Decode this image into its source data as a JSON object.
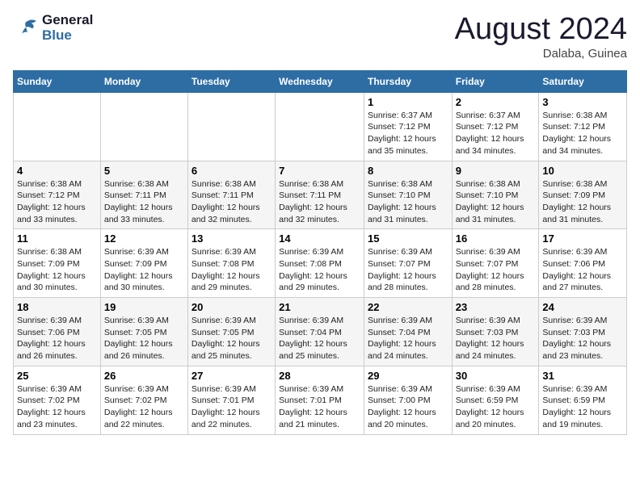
{
  "logo": {
    "line1": "General",
    "line2": "Blue"
  },
  "title": "August 2024",
  "location": "Dalaba, Guinea",
  "days_header": [
    "Sunday",
    "Monday",
    "Tuesday",
    "Wednesday",
    "Thursday",
    "Friday",
    "Saturday"
  ],
  "weeks": [
    [
      {
        "day": "",
        "info": ""
      },
      {
        "day": "",
        "info": ""
      },
      {
        "day": "",
        "info": ""
      },
      {
        "day": "",
        "info": ""
      },
      {
        "day": "1",
        "info": "Sunrise: 6:37 AM\nSunset: 7:12 PM\nDaylight: 12 hours\nand 35 minutes."
      },
      {
        "day": "2",
        "info": "Sunrise: 6:37 AM\nSunset: 7:12 PM\nDaylight: 12 hours\nand 34 minutes."
      },
      {
        "day": "3",
        "info": "Sunrise: 6:38 AM\nSunset: 7:12 PM\nDaylight: 12 hours\nand 34 minutes."
      }
    ],
    [
      {
        "day": "4",
        "info": "Sunrise: 6:38 AM\nSunset: 7:12 PM\nDaylight: 12 hours\nand 33 minutes."
      },
      {
        "day": "5",
        "info": "Sunrise: 6:38 AM\nSunset: 7:11 PM\nDaylight: 12 hours\nand 33 minutes."
      },
      {
        "day": "6",
        "info": "Sunrise: 6:38 AM\nSunset: 7:11 PM\nDaylight: 12 hours\nand 32 minutes."
      },
      {
        "day": "7",
        "info": "Sunrise: 6:38 AM\nSunset: 7:11 PM\nDaylight: 12 hours\nand 32 minutes."
      },
      {
        "day": "8",
        "info": "Sunrise: 6:38 AM\nSunset: 7:10 PM\nDaylight: 12 hours\nand 31 minutes."
      },
      {
        "day": "9",
        "info": "Sunrise: 6:38 AM\nSunset: 7:10 PM\nDaylight: 12 hours\nand 31 minutes."
      },
      {
        "day": "10",
        "info": "Sunrise: 6:38 AM\nSunset: 7:09 PM\nDaylight: 12 hours\nand 31 minutes."
      }
    ],
    [
      {
        "day": "11",
        "info": "Sunrise: 6:38 AM\nSunset: 7:09 PM\nDaylight: 12 hours\nand 30 minutes."
      },
      {
        "day": "12",
        "info": "Sunrise: 6:39 AM\nSunset: 7:09 PM\nDaylight: 12 hours\nand 30 minutes."
      },
      {
        "day": "13",
        "info": "Sunrise: 6:39 AM\nSunset: 7:08 PM\nDaylight: 12 hours\nand 29 minutes."
      },
      {
        "day": "14",
        "info": "Sunrise: 6:39 AM\nSunset: 7:08 PM\nDaylight: 12 hours\nand 29 minutes."
      },
      {
        "day": "15",
        "info": "Sunrise: 6:39 AM\nSunset: 7:07 PM\nDaylight: 12 hours\nand 28 minutes."
      },
      {
        "day": "16",
        "info": "Sunrise: 6:39 AM\nSunset: 7:07 PM\nDaylight: 12 hours\nand 28 minutes."
      },
      {
        "day": "17",
        "info": "Sunrise: 6:39 AM\nSunset: 7:06 PM\nDaylight: 12 hours\nand 27 minutes."
      }
    ],
    [
      {
        "day": "18",
        "info": "Sunrise: 6:39 AM\nSunset: 7:06 PM\nDaylight: 12 hours\nand 26 minutes."
      },
      {
        "day": "19",
        "info": "Sunrise: 6:39 AM\nSunset: 7:05 PM\nDaylight: 12 hours\nand 26 minutes."
      },
      {
        "day": "20",
        "info": "Sunrise: 6:39 AM\nSunset: 7:05 PM\nDaylight: 12 hours\nand 25 minutes."
      },
      {
        "day": "21",
        "info": "Sunrise: 6:39 AM\nSunset: 7:04 PM\nDaylight: 12 hours\nand 25 minutes."
      },
      {
        "day": "22",
        "info": "Sunrise: 6:39 AM\nSunset: 7:04 PM\nDaylight: 12 hours\nand 24 minutes."
      },
      {
        "day": "23",
        "info": "Sunrise: 6:39 AM\nSunset: 7:03 PM\nDaylight: 12 hours\nand 24 minutes."
      },
      {
        "day": "24",
        "info": "Sunrise: 6:39 AM\nSunset: 7:03 PM\nDaylight: 12 hours\nand 23 minutes."
      }
    ],
    [
      {
        "day": "25",
        "info": "Sunrise: 6:39 AM\nSunset: 7:02 PM\nDaylight: 12 hours\nand 23 minutes."
      },
      {
        "day": "26",
        "info": "Sunrise: 6:39 AM\nSunset: 7:02 PM\nDaylight: 12 hours\nand 22 minutes."
      },
      {
        "day": "27",
        "info": "Sunrise: 6:39 AM\nSunset: 7:01 PM\nDaylight: 12 hours\nand 22 minutes."
      },
      {
        "day": "28",
        "info": "Sunrise: 6:39 AM\nSunset: 7:01 PM\nDaylight: 12 hours\nand 21 minutes."
      },
      {
        "day": "29",
        "info": "Sunrise: 6:39 AM\nSunset: 7:00 PM\nDaylight: 12 hours\nand 20 minutes."
      },
      {
        "day": "30",
        "info": "Sunrise: 6:39 AM\nSunset: 6:59 PM\nDaylight: 12 hours\nand 20 minutes."
      },
      {
        "day": "31",
        "info": "Sunrise: 6:39 AM\nSunset: 6:59 PM\nDaylight: 12 hours\nand 19 minutes."
      }
    ]
  ]
}
